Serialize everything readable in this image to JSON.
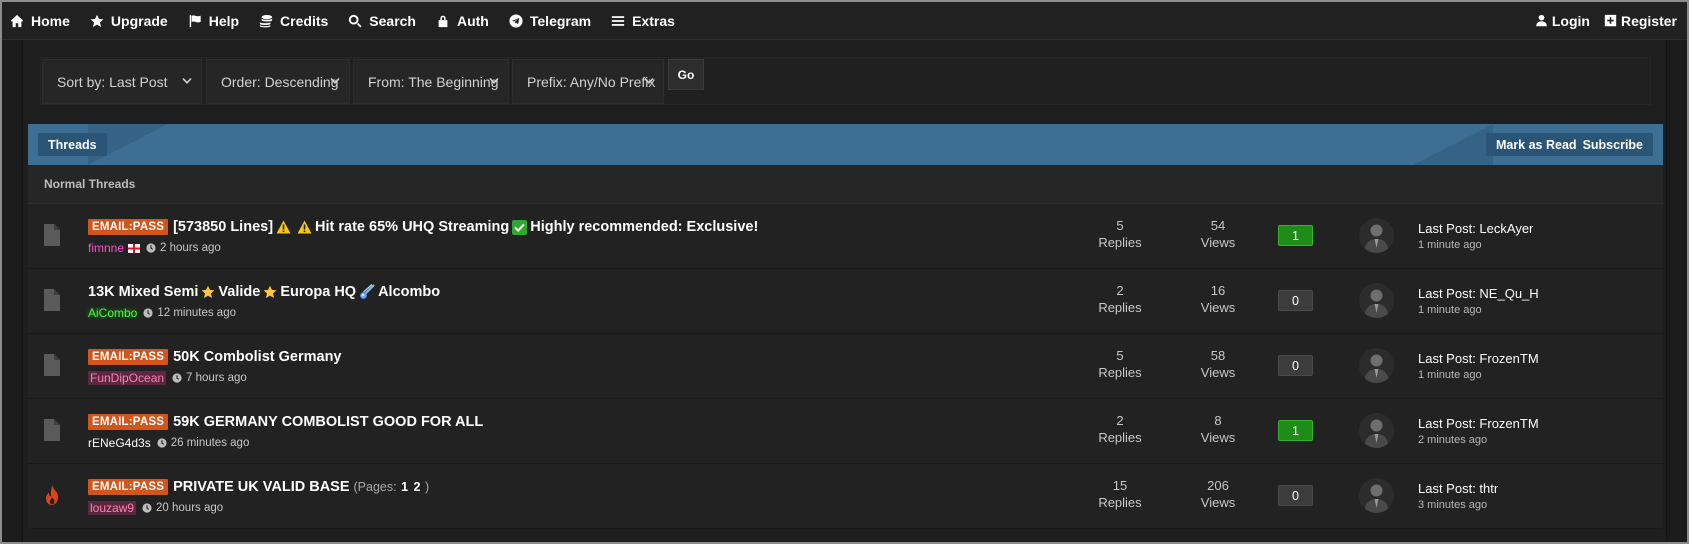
{
  "nav": {
    "left": [
      {
        "label": "Home",
        "icon": "home-icon"
      },
      {
        "label": "Upgrade",
        "icon": "star-icon"
      },
      {
        "label": "Help",
        "icon": "flag-icon"
      },
      {
        "label": "Credits",
        "icon": "coins-icon"
      },
      {
        "label": "Search",
        "icon": "search-icon"
      },
      {
        "label": "Auth",
        "icon": "lock-icon"
      },
      {
        "label": "Telegram",
        "icon": "telegram-icon"
      },
      {
        "label": "Extras",
        "icon": "menu-icon"
      }
    ],
    "right": [
      {
        "label": "Login",
        "icon": "user-icon"
      },
      {
        "label": "Register",
        "icon": "plus-square-icon"
      }
    ]
  },
  "filters": {
    "sort": "Sort by: Last Post",
    "order": "Order: Descending",
    "from": "From: The Beginning",
    "prefix": "Prefix: Any/No Prefix",
    "go": "Go"
  },
  "threads_header": {
    "title": "Threads",
    "mark_read": "Mark as Read",
    "subscribe": "Subscribe"
  },
  "section": {
    "title": "Normal Threads"
  },
  "colors": {
    "band_blue": "#3d6f95",
    "prefix_orange": "#d2561b",
    "count_green": "#1f8c1a",
    "hot_red": "#e0431c"
  },
  "threads": [
    {
      "icon": "document-icon",
      "prefix": "EMAIL:PASS",
      "title_parts": [
        "[573850 Lines]",
        "Hit rate 65% UHQ Streaming",
        "Highly recommended: Exclusive!"
      ],
      "author": "fimnne",
      "author_flag": "england-flag-icon",
      "time": "2 hours ago",
      "replies": "5",
      "replies_label": "Replies",
      "views": "54",
      "views_label": "Views",
      "count": "1",
      "last_post": "Last Post: LeckAyer",
      "last_time": "1 minute ago"
    },
    {
      "icon": "document-icon",
      "prefix": "",
      "title_parts": [
        "13K Mixed Semi",
        "Valide",
        "Europa HQ",
        "Alcombo"
      ],
      "author": "AiCombo",
      "time": "12 minutes ago",
      "replies": "2",
      "replies_label": "Replies",
      "views": "16",
      "views_label": "Views",
      "count": "0",
      "last_post": "Last Post: NE_Qu_H",
      "last_time": "1 minute ago"
    },
    {
      "icon": "document-icon",
      "prefix": "EMAIL:PASS",
      "title": "50K Combolist Germany",
      "author": "FunDipOcean",
      "time": "7 hours ago",
      "replies": "5",
      "replies_label": "Replies",
      "views": "58",
      "views_label": "Views",
      "count": "0",
      "last_post": "Last Post: FrozenTM",
      "last_time": "1 minute ago"
    },
    {
      "icon": "document-icon",
      "prefix": "EMAIL:PASS",
      "title": "59K GERMANY COMBOLIST GOOD FOR ALL",
      "author": "rENeG4d3s",
      "time": "26 minutes ago",
      "replies": "2",
      "replies_label": "Replies",
      "views": "8",
      "views_label": "Views",
      "count": "1",
      "last_post": "Last Post: FrozenTM",
      "last_time": "2 minutes ago"
    },
    {
      "icon": "fire-icon",
      "prefix": "EMAIL:PASS",
      "title": "PRIVATE UK VALID BASE",
      "pages_open": "(Pages:",
      "pages": [
        "1",
        "2"
      ],
      "pages_close": ")",
      "author": "louzaw9",
      "time": "20 hours ago",
      "replies": "15",
      "replies_label": "Replies",
      "views": "206",
      "views_label": "Views",
      "count": "0",
      "last_post": "Last Post: thtr",
      "last_time": "3 minutes ago"
    }
  ]
}
